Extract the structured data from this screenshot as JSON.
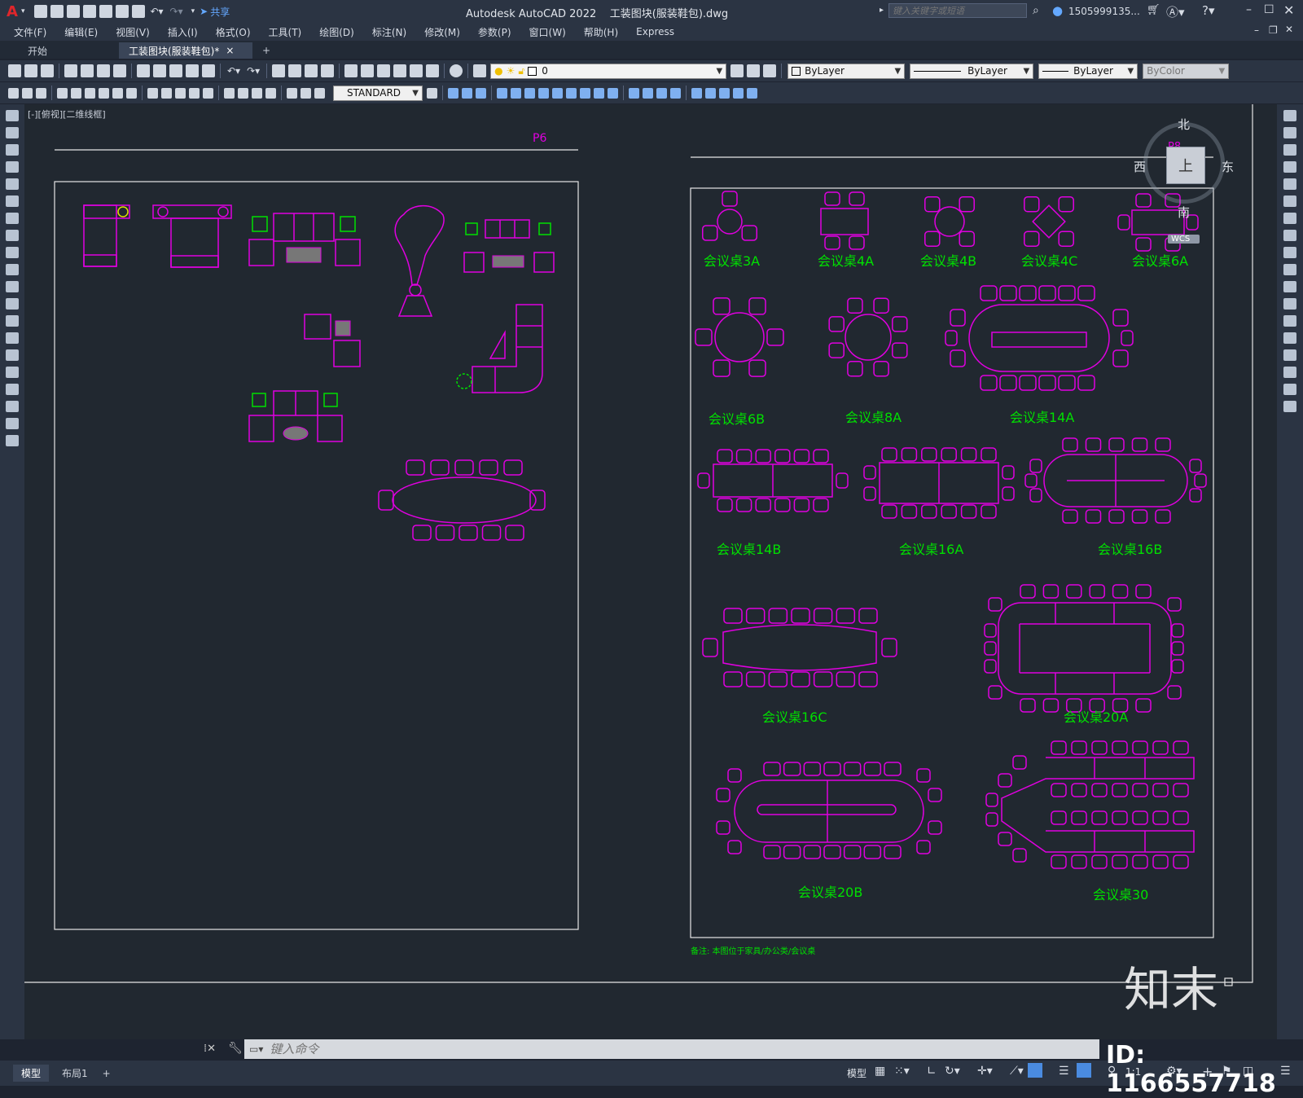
{
  "titlebar": {
    "app_logo": "A",
    "share_label": "共享",
    "title": "Autodesk AutoCAD 2022    工装图块(服装鞋包).dwg",
    "search_placeholder": "键入关键字或短语",
    "user": "1505999135...",
    "help_icon": "help-icon"
  },
  "menu": [
    "文件(F)",
    "编辑(E)",
    "视图(V)",
    "插入(I)",
    "格式(O)",
    "工具(T)",
    "绘图(D)",
    "标注(N)",
    "修改(M)",
    "参数(P)",
    "窗口(W)",
    "帮助(H)",
    "Express"
  ],
  "tabs": {
    "start": "开始",
    "file": "工装图块(服装鞋包)*",
    "close": "×",
    "add": "+"
  },
  "toolbar1": {
    "layer_value": "0",
    "color": "ByLayer",
    "linetype": "ByLayer",
    "lineweight": "ByLayer",
    "plotstyle": "ByColor"
  },
  "toolbar2": {
    "textstyle": "STANDARD"
  },
  "viewport": {
    "label": "[-][俯视][二维线框]"
  },
  "viewcube": {
    "north": "北",
    "south": "南",
    "west": "西",
    "east": "东",
    "top": "上",
    "wcs": "WCS"
  },
  "drawing": {
    "left_sheet_label": "P6",
    "right_sheet_label": "P8",
    "tables": [
      "会议桌3A",
      "会议桌4A",
      "会议桌4B",
      "会议桌4C",
      "会议桌6A",
      "会议桌6B",
      "会议桌8A",
      "会议桌14A",
      "会议桌14B",
      "会议桌16A",
      "会议桌16B",
      "会议桌16C",
      "会议桌20A",
      "会议桌20B",
      "会议桌30"
    ],
    "note": "备注: 本图位于家具/办公类/会议桌"
  },
  "command": {
    "placeholder": "键入命令"
  },
  "layout_tabs": {
    "model": "模型",
    "layout1": "布局1",
    "add": "+"
  },
  "status": {
    "model": "模型",
    "scale": "1:1"
  },
  "watermark": {
    "brand": "知末",
    "id": "ID: 1166557718"
  },
  "colors": {
    "magenta": "#e000e0",
    "green": "#00e000",
    "canvas": "#212830"
  }
}
